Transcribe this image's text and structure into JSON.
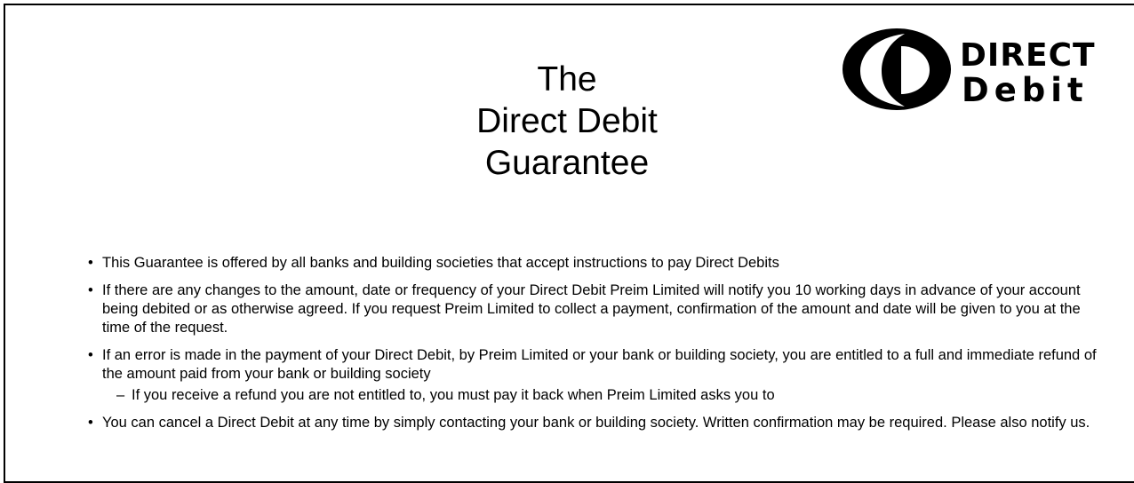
{
  "title": {
    "line1": "The",
    "line2": "Direct Debit",
    "line3": "Guarantee"
  },
  "logo": {
    "icon": "direct-debit-logo",
    "text_top": "DIRECT",
    "text_bottom": "Debit",
    "color": "#000000"
  },
  "items": [
    {
      "text": "This Guarantee is offered by all banks and building societies that accept instructions to pay Direct Debits"
    },
    {
      "text": "If there are any changes to the amount, date or frequency of your Direct Debit Preim Limited will notify you 10 working days in advance of your account being debited or as otherwise agreed. If you request Preim Limited to collect a payment, confirmation of the amount and date will be given to you at the time of the request."
    },
    {
      "text": "If an error is made in the payment of your Direct Debit, by Preim Limited or your bank or building society, you are entitled to a full and immediate refund of the amount paid from your bank or building society",
      "sub": "If you receive a refund you are not entitled to, you must pay it back when Preim Limited asks you to"
    },
    {
      "text": "You can cancel a Direct Debit at any time by simply contacting your bank or building society. Written confirmation may be required. Please also notify us."
    }
  ]
}
